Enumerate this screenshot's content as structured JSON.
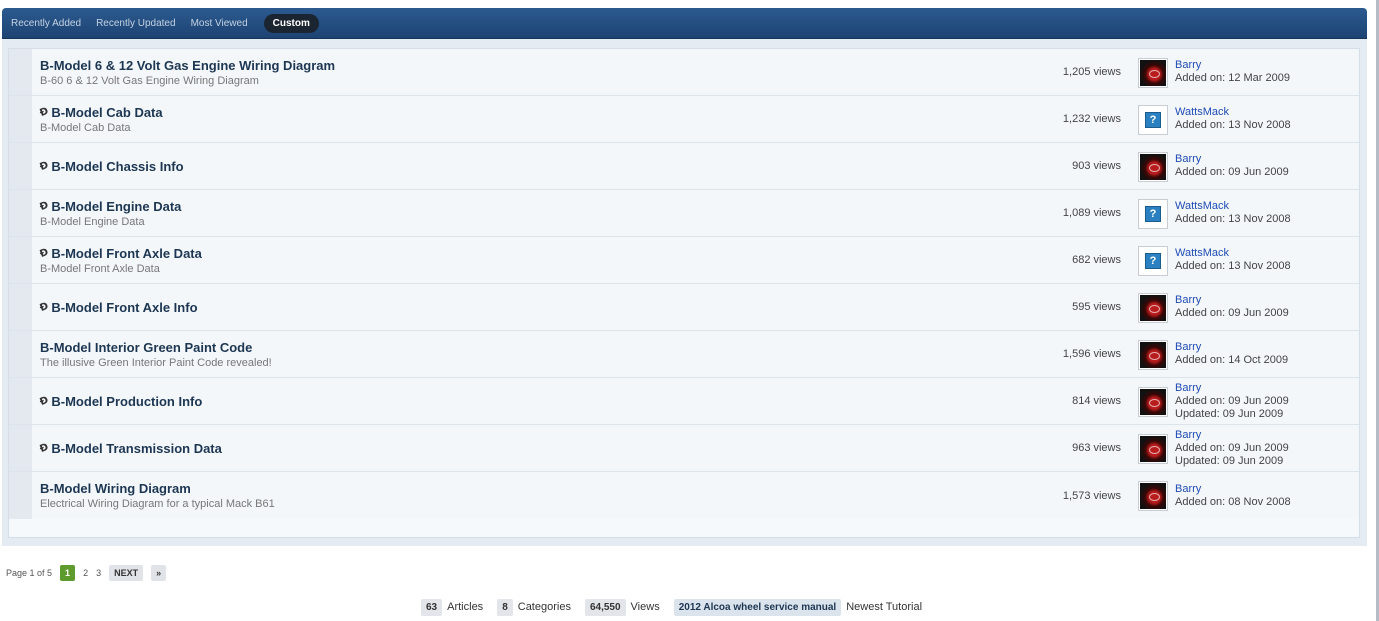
{
  "tabs": [
    "Recently Added",
    "Recently Updated",
    "Most Viewed",
    "Custom"
  ],
  "active_tab": "Custom",
  "articles": [
    {
      "title": "B-Model 6 & 12 Volt Gas Engine Wiring Diagram",
      "desc": "B-60 6 & 12 Volt Gas Engine Wiring Diagram",
      "attachment": false,
      "views": "1,205 views",
      "author": "Barry",
      "avatar": "barry-avatar",
      "added": "Added on: 12 Mar 2009",
      "updated": ""
    },
    {
      "title": "B-Model Cab Data",
      "desc": "B-Model Cab Data",
      "attachment": true,
      "views": "1,232 views",
      "author": "WattsMack",
      "avatar": "default-avatar",
      "added": "Added on: 13 Nov 2008",
      "updated": ""
    },
    {
      "title": "B-Model Chassis Info",
      "desc": "",
      "attachment": true,
      "views": "903 views",
      "author": "Barry",
      "avatar": "barry-avatar",
      "added": "Added on: 09 Jun 2009",
      "updated": ""
    },
    {
      "title": "B-Model Engine Data",
      "desc": "B-Model Engine Data",
      "attachment": true,
      "views": "1,089 views",
      "author": "WattsMack",
      "avatar": "default-avatar",
      "added": "Added on: 13 Nov 2008",
      "updated": ""
    },
    {
      "title": "B-Model Front Axle Data",
      "desc": "B-Model Front Axle Data",
      "attachment": true,
      "views": "682 views",
      "author": "WattsMack",
      "avatar": "default-avatar",
      "added": "Added on: 13 Nov 2008",
      "updated": ""
    },
    {
      "title": "B-Model Front Axle Info",
      "desc": "",
      "attachment": true,
      "views": "595 views",
      "author": "Barry",
      "avatar": "barry-avatar",
      "added": "Added on: 09 Jun 2009",
      "updated": ""
    },
    {
      "title": "B-Model Interior Green Paint Code",
      "desc": "The illusive Green Interior Paint Code revealed!",
      "attachment": false,
      "views": "1,596 views",
      "author": "Barry",
      "avatar": "barry-avatar",
      "added": "Added on: 14 Oct 2009",
      "updated": ""
    },
    {
      "title": "B-Model Production Info",
      "desc": "",
      "attachment": true,
      "views": "814 views",
      "author": "Barry",
      "avatar": "barry-avatar",
      "added": "Added on: 09 Jun 2009",
      "updated": "Updated: 09 Jun 2009"
    },
    {
      "title": "B-Model Transmission Data",
      "desc": "",
      "attachment": true,
      "views": "963 views",
      "author": "Barry",
      "avatar": "barry-avatar",
      "added": "Added on: 09 Jun 2009",
      "updated": "Updated: 09 Jun 2009"
    },
    {
      "title": "B-Model Wiring Diagram",
      "desc": "Electrical Wiring Diagram for a typical Mack B61",
      "attachment": false,
      "views": "1,573 views",
      "author": "Barry",
      "avatar": "barry-avatar",
      "added": "Added on: 08 Nov 2008",
      "updated": ""
    }
  ],
  "attachment_glyph": "Ɖ",
  "pagination": {
    "label": "Page 1 of 5",
    "pages": [
      "1",
      "2",
      "3"
    ],
    "current": "1",
    "next": "NEXT",
    "last": "»"
  },
  "stats": {
    "articles_count": "63",
    "articles_label": "Articles",
    "categories_count": "8",
    "categories_label": "Categories",
    "views_count": "64,550",
    "views_label": "Views",
    "newest_title": "2012 Alcoa wheel service manual",
    "newest_label": "Newest Tutorial"
  },
  "colors": {
    "header_bar": "#1d4373",
    "active_tab": "#1b2532",
    "title_link": "#1d3652",
    "author_link": "#1f4cb5",
    "current_page": "#5d9b2f"
  }
}
